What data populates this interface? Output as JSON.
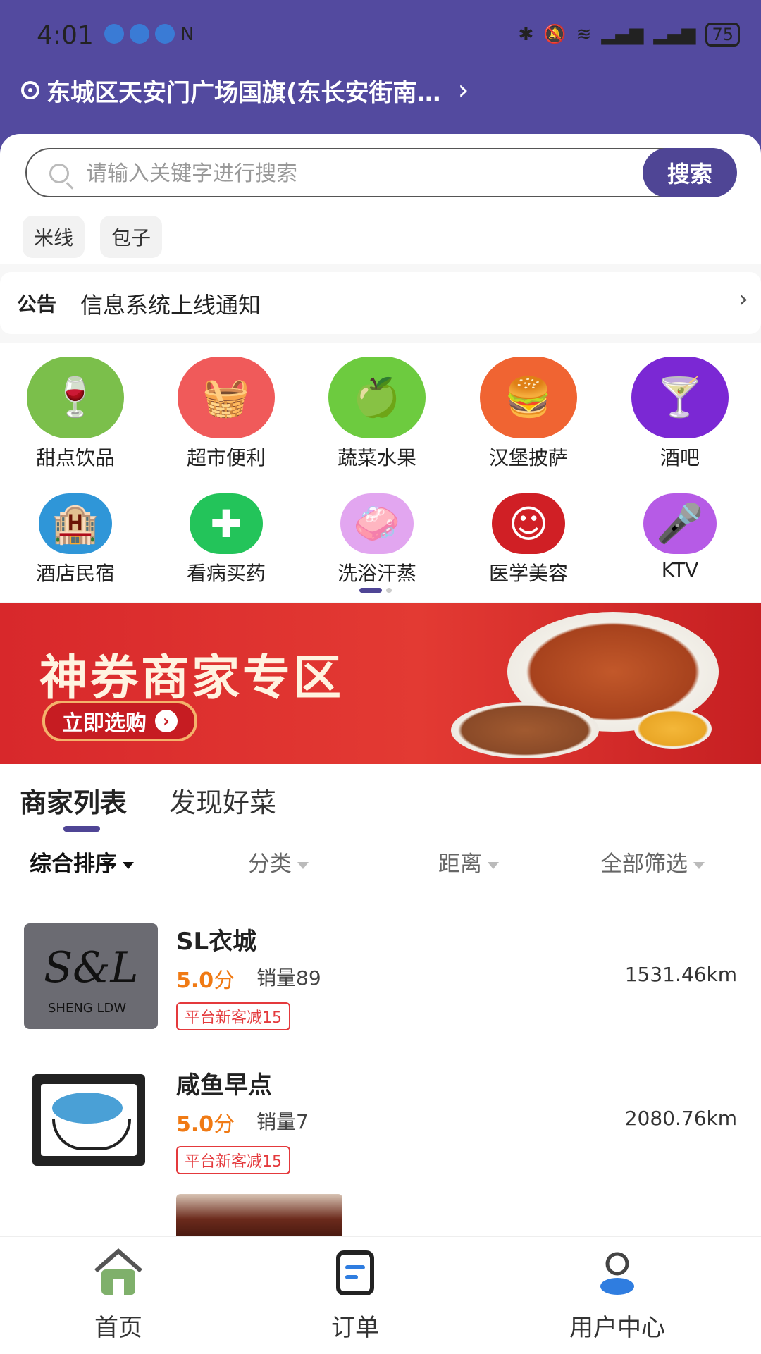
{
  "status_bar": {
    "time": "4:01",
    "battery": "75"
  },
  "header": {
    "location": "东城区天安门广场国旗(东长安街南…"
  },
  "search": {
    "placeholder": "请输入关键字进行搜索",
    "button_label": "搜索"
  },
  "hot_tags": [
    "米线",
    "包子"
  ],
  "notice": {
    "label": "公告",
    "text": "信息系统上线通知"
  },
  "categories": [
    {
      "label": "甜点饮品",
      "icon": "drink-icon",
      "color": "#7bbf4b"
    },
    {
      "label": "超市便利",
      "icon": "basket-icon",
      "color": "#f05a5a"
    },
    {
      "label": "蔬菜水果",
      "icon": "apple-icon",
      "color": "#6dcb3f"
    },
    {
      "label": "汉堡披萨",
      "icon": "burger-icon",
      "color": "#f06432"
    },
    {
      "label": "酒吧",
      "icon": "cocktail-icon",
      "color": "#7b28d4"
    },
    {
      "label": "酒店民宿",
      "icon": "building-icon",
      "color": "#2f96d8"
    },
    {
      "label": "看病买药",
      "icon": "medicine-icon",
      "color": "#23c45a"
    },
    {
      "label": "洗浴汗蒸",
      "icon": "bath-icon",
      "color": "#e2a6f0"
    },
    {
      "label": "医学美容",
      "icon": "face-icon",
      "color": "#d01f25"
    },
    {
      "label": "KTV",
      "icon": "microphone-icon",
      "color": "#b65be6"
    }
  ],
  "banner": {
    "title": "神券商家专区",
    "cta": "立即选购"
  },
  "list_tabs": {
    "active": "商家列表",
    "other": "发现好菜"
  },
  "filters": {
    "sort": "综合排序",
    "category": "分类",
    "distance": "距离",
    "all": "全部筛选"
  },
  "shops": [
    {
      "name": "SL衣城",
      "score": "5.0",
      "score_unit": "分",
      "sales": "销量89",
      "distance": "1531.46km",
      "promo": "平台新客减15",
      "logo_text": "S&L",
      "logo_sub": "SHENG LDW"
    },
    {
      "name": "咸鱼早点",
      "score": "5.0",
      "score_unit": "分",
      "sales": "销量7",
      "distance": "2080.76km",
      "promo": "平台新客减15"
    }
  ],
  "bottom_nav": [
    {
      "label": "首页",
      "icon": "home-icon"
    },
    {
      "label": "订单",
      "icon": "order-icon"
    },
    {
      "label": "用户中心",
      "icon": "user-icon"
    }
  ],
  "colors": {
    "primary": "#4f4595",
    "header_bg": "#534a9f",
    "banner_bg": "#d8282b",
    "score": "#f07a14",
    "promo": "#e4393c"
  }
}
